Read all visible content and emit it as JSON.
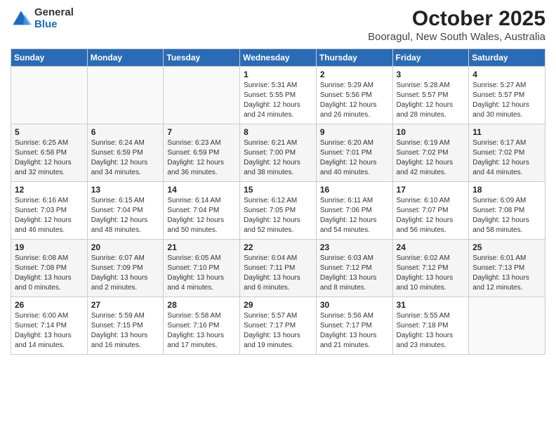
{
  "logo": {
    "general": "General",
    "blue": "Blue"
  },
  "header": {
    "title": "October 2025",
    "location": "Booragul, New South Wales, Australia"
  },
  "days_of_week": [
    "Sunday",
    "Monday",
    "Tuesday",
    "Wednesday",
    "Thursday",
    "Friday",
    "Saturday"
  ],
  "weeks": [
    [
      {
        "day": "",
        "info": ""
      },
      {
        "day": "",
        "info": ""
      },
      {
        "day": "",
        "info": ""
      },
      {
        "day": "1",
        "info": "Sunrise: 5:31 AM\nSunset: 5:55 PM\nDaylight: 12 hours\nand 24 minutes."
      },
      {
        "day": "2",
        "info": "Sunrise: 5:29 AM\nSunset: 5:56 PM\nDaylight: 12 hours\nand 26 minutes."
      },
      {
        "day": "3",
        "info": "Sunrise: 5:28 AM\nSunset: 5:57 PM\nDaylight: 12 hours\nand 28 minutes."
      },
      {
        "day": "4",
        "info": "Sunrise: 5:27 AM\nSunset: 5:57 PM\nDaylight: 12 hours\nand 30 minutes."
      }
    ],
    [
      {
        "day": "5",
        "info": "Sunrise: 6:25 AM\nSunset: 6:58 PM\nDaylight: 12 hours\nand 32 minutes."
      },
      {
        "day": "6",
        "info": "Sunrise: 6:24 AM\nSunset: 6:59 PM\nDaylight: 12 hours\nand 34 minutes."
      },
      {
        "day": "7",
        "info": "Sunrise: 6:23 AM\nSunset: 6:59 PM\nDaylight: 12 hours\nand 36 minutes."
      },
      {
        "day": "8",
        "info": "Sunrise: 6:21 AM\nSunset: 7:00 PM\nDaylight: 12 hours\nand 38 minutes."
      },
      {
        "day": "9",
        "info": "Sunrise: 6:20 AM\nSunset: 7:01 PM\nDaylight: 12 hours\nand 40 minutes."
      },
      {
        "day": "10",
        "info": "Sunrise: 6:19 AM\nSunset: 7:02 PM\nDaylight: 12 hours\nand 42 minutes."
      },
      {
        "day": "11",
        "info": "Sunrise: 6:17 AM\nSunset: 7:02 PM\nDaylight: 12 hours\nand 44 minutes."
      }
    ],
    [
      {
        "day": "12",
        "info": "Sunrise: 6:16 AM\nSunset: 7:03 PM\nDaylight: 12 hours\nand 46 minutes."
      },
      {
        "day": "13",
        "info": "Sunrise: 6:15 AM\nSunset: 7:04 PM\nDaylight: 12 hours\nand 48 minutes."
      },
      {
        "day": "14",
        "info": "Sunrise: 6:14 AM\nSunset: 7:04 PM\nDaylight: 12 hours\nand 50 minutes."
      },
      {
        "day": "15",
        "info": "Sunrise: 6:12 AM\nSunset: 7:05 PM\nDaylight: 12 hours\nand 52 minutes."
      },
      {
        "day": "16",
        "info": "Sunrise: 6:11 AM\nSunset: 7:06 PM\nDaylight: 12 hours\nand 54 minutes."
      },
      {
        "day": "17",
        "info": "Sunrise: 6:10 AM\nSunset: 7:07 PM\nDaylight: 12 hours\nand 56 minutes."
      },
      {
        "day": "18",
        "info": "Sunrise: 6:09 AM\nSunset: 7:08 PM\nDaylight: 12 hours\nand 58 minutes."
      }
    ],
    [
      {
        "day": "19",
        "info": "Sunrise: 6:08 AM\nSunset: 7:08 PM\nDaylight: 13 hours\nand 0 minutes."
      },
      {
        "day": "20",
        "info": "Sunrise: 6:07 AM\nSunset: 7:09 PM\nDaylight: 13 hours\nand 2 minutes."
      },
      {
        "day": "21",
        "info": "Sunrise: 6:05 AM\nSunset: 7:10 PM\nDaylight: 13 hours\nand 4 minutes."
      },
      {
        "day": "22",
        "info": "Sunrise: 6:04 AM\nSunset: 7:11 PM\nDaylight: 13 hours\nand 6 minutes."
      },
      {
        "day": "23",
        "info": "Sunrise: 6:03 AM\nSunset: 7:12 PM\nDaylight: 13 hours\nand 8 minutes."
      },
      {
        "day": "24",
        "info": "Sunrise: 6:02 AM\nSunset: 7:12 PM\nDaylight: 13 hours\nand 10 minutes."
      },
      {
        "day": "25",
        "info": "Sunrise: 6:01 AM\nSunset: 7:13 PM\nDaylight: 13 hours\nand 12 minutes."
      }
    ],
    [
      {
        "day": "26",
        "info": "Sunrise: 6:00 AM\nSunset: 7:14 PM\nDaylight: 13 hours\nand 14 minutes."
      },
      {
        "day": "27",
        "info": "Sunrise: 5:59 AM\nSunset: 7:15 PM\nDaylight: 13 hours\nand 16 minutes."
      },
      {
        "day": "28",
        "info": "Sunrise: 5:58 AM\nSunset: 7:16 PM\nDaylight: 13 hours\nand 17 minutes."
      },
      {
        "day": "29",
        "info": "Sunrise: 5:57 AM\nSunset: 7:17 PM\nDaylight: 13 hours\nand 19 minutes."
      },
      {
        "day": "30",
        "info": "Sunrise: 5:56 AM\nSunset: 7:17 PM\nDaylight: 13 hours\nand 21 minutes."
      },
      {
        "day": "31",
        "info": "Sunrise: 5:55 AM\nSunset: 7:18 PM\nDaylight: 13 hours\nand 23 minutes."
      },
      {
        "day": "",
        "info": ""
      }
    ]
  ]
}
